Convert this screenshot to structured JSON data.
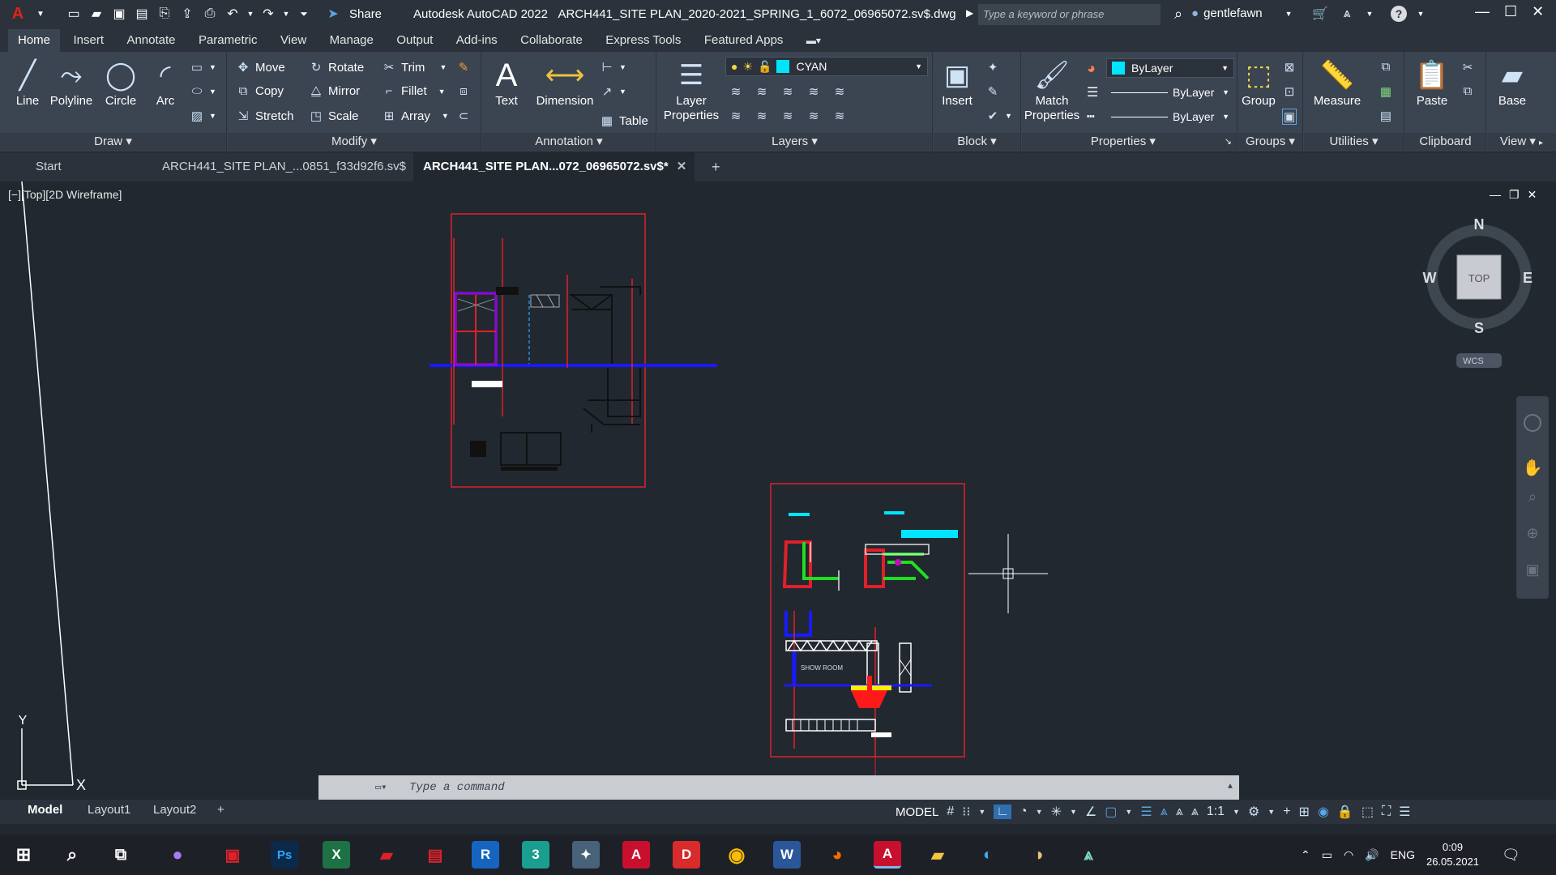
{
  "titlebar": {
    "app_logo": "A",
    "share_label": "Share",
    "app_title": "Autodesk AutoCAD 2022",
    "file_title": "ARCH441_SITE PLAN_2020-2021_SPRING_1_6072_06965072.sv$.dwg",
    "search_placeholder": "Type a keyword or phrase",
    "username": "gentlefawn"
  },
  "menu_tabs": [
    "Home",
    "Insert",
    "Annotate",
    "Parametric",
    "View",
    "Manage",
    "Output",
    "Add-ins",
    "Collaborate",
    "Express Tools",
    "Featured Apps"
  ],
  "ribbon": {
    "draw": {
      "title": "Draw",
      "line": "Line",
      "polyline": "Polyline",
      "circle": "Circle",
      "arc": "Arc"
    },
    "modify": {
      "title": "Modify",
      "move": "Move",
      "rotate": "Rotate",
      "trim": "Trim",
      "copy": "Copy",
      "mirror": "Mirror",
      "fillet": "Fillet",
      "stretch": "Stretch",
      "scale": "Scale",
      "array": "Array"
    },
    "annotation": {
      "title": "Annotation",
      "text": "Text",
      "dimension": "Dimension",
      "table": "Table"
    },
    "layers": {
      "title": "Layers",
      "layer_properties": "Layer Properties",
      "current_layer": "CYAN",
      "layer_color": "#00e5ff"
    },
    "block": {
      "title": "Block",
      "insert": "Insert"
    },
    "properties": {
      "title": "Properties",
      "match": "Match Properties",
      "color": "ByLayer",
      "linetype": "ByLayer",
      "lineweight": "ByLayer"
    },
    "groups": {
      "title": "Groups",
      "group": "Group"
    },
    "utilities": {
      "title": "Utilities",
      "measure": "Measure"
    },
    "clipboard": {
      "title": "Clipboard",
      "paste": "Paste"
    },
    "view": {
      "title": "View",
      "base": "Base"
    }
  },
  "doc_tabs": {
    "start": "Start",
    "tab1": "ARCH441_SITE PLAN_...0851_f33d92f6.sv$",
    "tab2": "ARCH441_SITE PLAN...072_06965072.sv$*"
  },
  "viewport": {
    "label": "[−][Top][2D Wireframe]",
    "compass": {
      "n": "N",
      "s": "S",
      "e": "E",
      "w": "W",
      "top": "TOP",
      "wcs": "WCS"
    },
    "drawing_text": "SHOW ROOM",
    "ucs_x": "X",
    "ucs_y": "Y"
  },
  "command_line": {
    "placeholder": "Type a command"
  },
  "layout_tabs": [
    "Model",
    "Layout1",
    "Layout2"
  ],
  "status": {
    "model": "MODEL",
    "scale": "1:1"
  },
  "taskbar": {
    "apps": [
      {
        "label": "R",
        "color": "#1565c0"
      },
      {
        "label": "3",
        "color": "#1a9e8f"
      },
      {
        "label": "Ps",
        "color": "#0b2a4a"
      },
      {
        "label": "X",
        "color": "#1e7145"
      },
      {
        "label": "A",
        "color": "#c8102e"
      },
      {
        "label": "D",
        "color": "#d92b2b"
      },
      {
        "label": "W",
        "color": "#2b579a"
      },
      {
        "label": "A",
        "color": "#c8102e"
      }
    ],
    "lang": "ENG",
    "time": "0:09",
    "date": "26.05.2021"
  }
}
